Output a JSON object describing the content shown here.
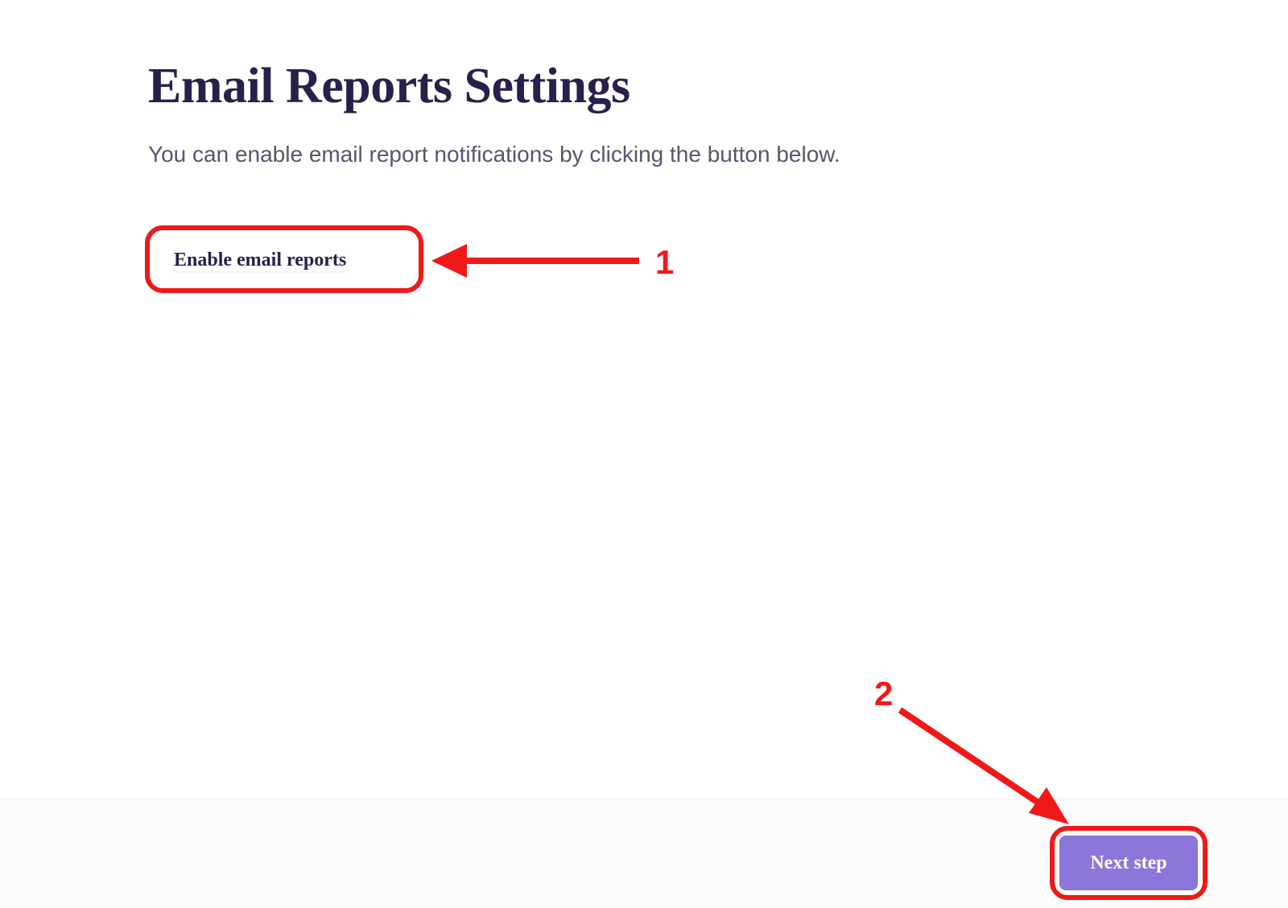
{
  "title": "Email Reports Settings",
  "subtitle": "You can enable email report notifications by clicking the button below.",
  "buttons": {
    "enable_label": "Enable email reports",
    "next_label": "Next step"
  },
  "annotations": {
    "one": "1",
    "two": "2"
  },
  "colors": {
    "heading": "#2a1f4a",
    "subtitle": "#5a5470",
    "highlight": "#f01818",
    "primary_button_bg": "#8a77d9",
    "primary_button_text": "#ffffff"
  }
}
